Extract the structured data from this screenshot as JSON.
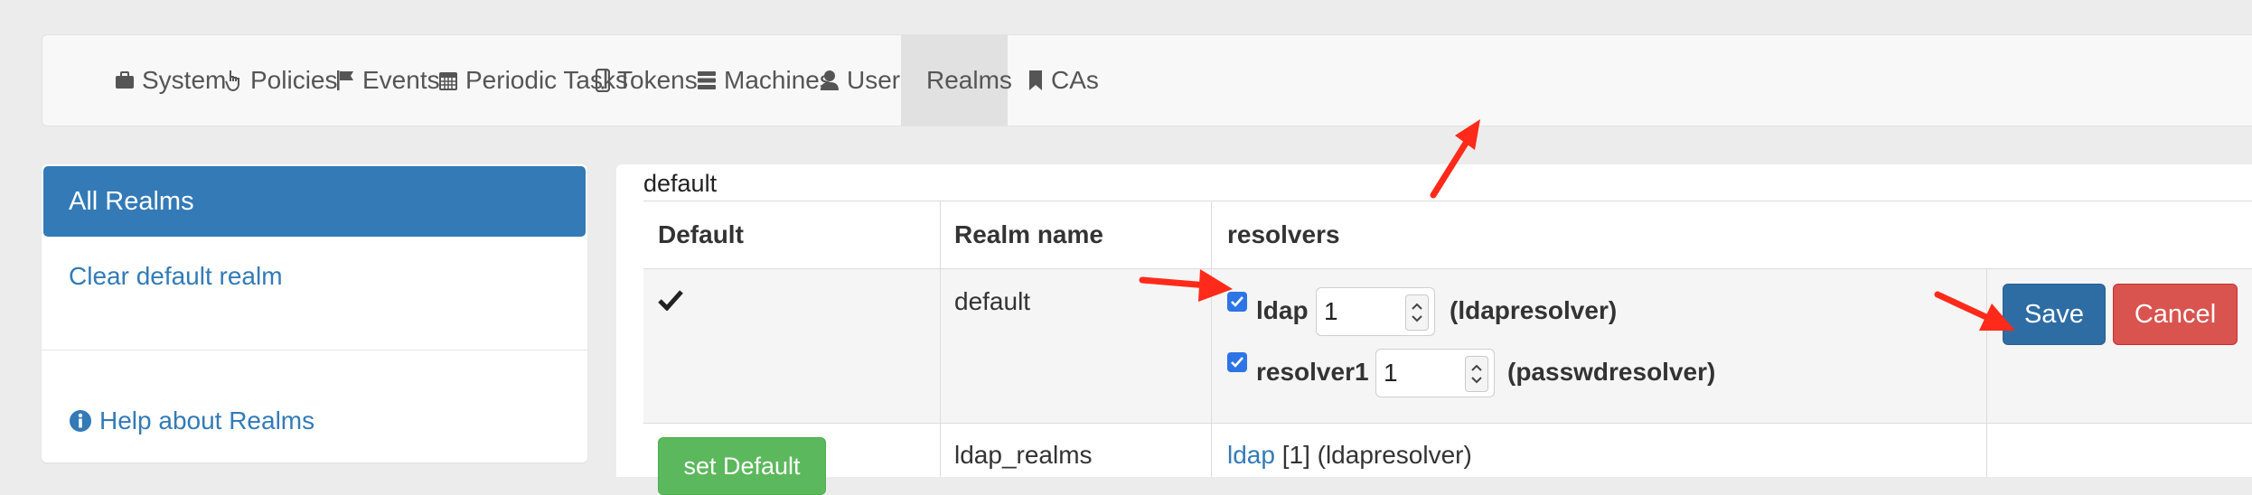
{
  "nav": {
    "items": [
      {
        "label": "System",
        "icon": "briefcase-icon"
      },
      {
        "label": "Policies",
        "icon": "hand-pointer-icon"
      },
      {
        "label": "Events",
        "icon": "flag-icon"
      },
      {
        "label": "Periodic Tasks",
        "icon": "calendar-icon"
      },
      {
        "label": "Tokens",
        "icon": "phone-icon"
      },
      {
        "label": "Machines",
        "icon": "server-icon"
      },
      {
        "label": "Users",
        "icon": "user-icon"
      },
      {
        "label": "Realms",
        "icon": "globe-icon",
        "active": true
      },
      {
        "label": "CAs",
        "icon": "bookmark-icon"
      }
    ]
  },
  "sidebar": {
    "active": "All Realms",
    "clear_default": "Clear default realm",
    "help": "Help about Realms"
  },
  "main": {
    "title": "default",
    "headers": {
      "default": "Default",
      "realm_name": "Realm name",
      "resolvers": "resolvers"
    },
    "rows": [
      {
        "is_default": true,
        "realm_name": "default",
        "resolvers": [
          {
            "name": "ldap",
            "priority": "1",
            "type": "(ldapresolver)",
            "checked": true
          },
          {
            "name": "resolver1",
            "priority": "1",
            "type": "(passwdresolver)",
            "checked": true
          }
        ],
        "save_label": "Save",
        "cancel_label": "Cancel"
      },
      {
        "set_default_label": "set Default",
        "realm_name": "ldap_realms",
        "resolver_link": "ldap",
        "resolver_rest": "[1] (ldapresolver)"
      }
    ]
  },
  "colors": {
    "primary": "#337ab7",
    "success": "#5cb85c",
    "danger": "#d9534f",
    "annotation": "#ff2a1a"
  }
}
